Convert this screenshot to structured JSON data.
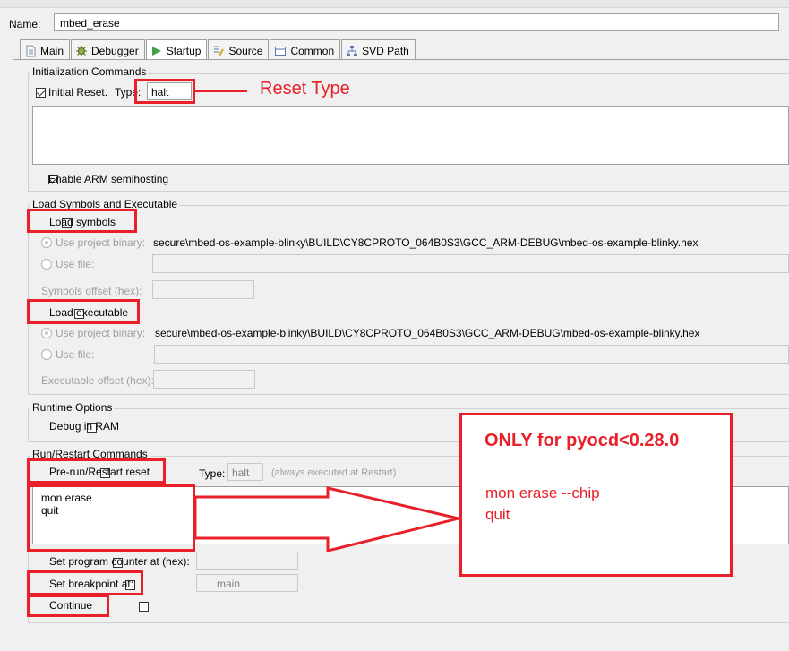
{
  "header": {
    "name_label": "Name:",
    "name_value": "mbed_erase"
  },
  "tabs": [
    {
      "label": "Main",
      "icon": "document-icon"
    },
    {
      "label": "Debugger",
      "icon": "bug-icon"
    },
    {
      "label": "Startup",
      "icon": "play-icon"
    },
    {
      "label": "Source",
      "icon": "source-icon"
    },
    {
      "label": "Common",
      "icon": "common-icon"
    },
    {
      "label": "SVD Path",
      "icon": "svd-icon"
    }
  ],
  "init": {
    "title": "Initialization Commands",
    "initial_reset_label": "Initial Reset.",
    "type_label": "Type:",
    "type_value": "halt",
    "semihosting_label": "Enable ARM semihosting"
  },
  "load": {
    "title": "Load Symbols and Executable",
    "load_symbols_label": "Load symbols",
    "use_project_binary_label": "Use project binary:",
    "symbols_path": "secure\\mbed-os-example-blinky\\BUILD\\CY8CPROTO_064B0S3\\GCC_ARM-DEBUG\\mbed-os-example-blinky.hex",
    "use_file_label": "Use file:",
    "symbols_offset_label": "Symbols offset (hex):",
    "load_executable_label": "Load executable",
    "exec_path": "secure\\mbed-os-example-blinky\\BUILD\\CY8CPROTO_064B0S3\\GCC_ARM-DEBUG\\mbed-os-example-blinky.hex",
    "exec_offset_label": "Executable offset (hex):"
  },
  "runtime": {
    "title": "Runtime Options",
    "debug_in_ram_label": "Debug in RAM"
  },
  "run": {
    "title": "Run/Restart Commands",
    "prerun_label": "Pre-run/Restart reset",
    "type_label": "Type:",
    "type_value": "halt",
    "always_note": "(always executed at Restart)",
    "commands_line1": "mon erase",
    "commands_line2": "quit",
    "set_pc_label": "Set program counter at (hex):",
    "set_breakpoint_label": "Set breakpoint at:",
    "breakpoint_value": "main",
    "continue_label": "Continue"
  },
  "annotations": {
    "reset_type": "Reset Type",
    "note_title": "ONLY for pyocd<0.28.0",
    "note_line1": "mon erase --chip",
    "note_line2": "quit",
    "color": "#e8202a"
  }
}
